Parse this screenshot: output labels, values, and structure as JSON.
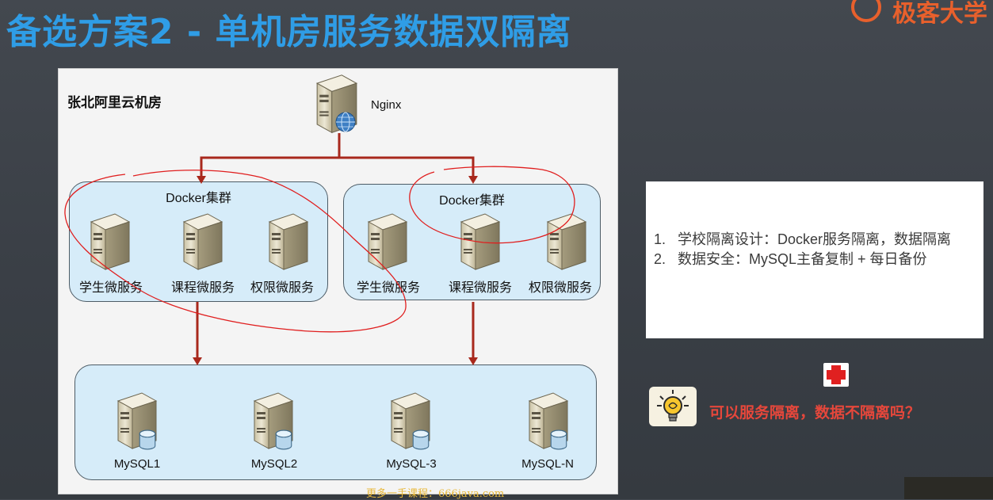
{
  "slide": {
    "title": "备选方案2 - 单机房服务数据双隔离",
    "logo_text": "极客大学",
    "room_label": "张北阿里云机房",
    "nginx_label": "Nginx",
    "clusters": [
      {
        "title": "Docker集群",
        "services": [
          "学生微服务",
          "课程微服务",
          "权限微服务"
        ]
      },
      {
        "title": "Docker集群",
        "services": [
          "学生微服务",
          "课程微服务",
          "权限微服务"
        ]
      }
    ],
    "databases": [
      "MySQL1",
      "MySQL2",
      "MySQL-3",
      "MySQL-N"
    ],
    "notes": [
      {
        "num": "1.",
        "text": "学校隔离设计：Docker服务隔离，数据隔离"
      },
      {
        "num": "2.",
        "text": "数据安全：MySQL主备复制 + 每日备份"
      }
    ],
    "question": "可以服务隔离，数据不隔离吗？",
    "watermark": "更多一手课程：666java.com"
  },
  "colors": {
    "title": "#2f9de6",
    "accent": "#e8602c",
    "arrow": "#a8281c",
    "cluster_fill": "#d6ecf9",
    "question": "#e6473b"
  },
  "icons": [
    "server-icon",
    "globe-icon",
    "database-icon",
    "lightbulb-icon",
    "red-cross-icon"
  ]
}
